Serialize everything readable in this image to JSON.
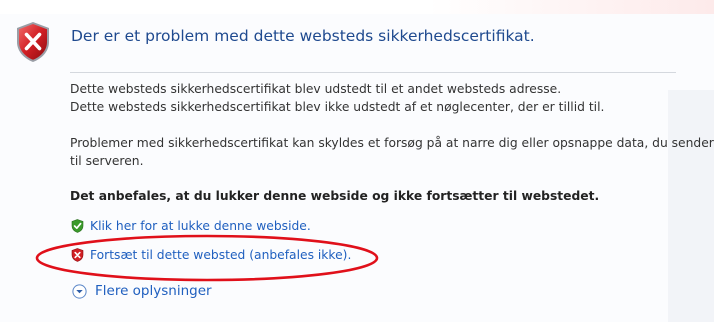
{
  "page": {
    "title": "Der er et problem med dette websteds sikkerhedscertifikat.",
    "paragraph1": [
      "Dette websteds sikkerhedscertifikat blev udstedt til et andet websteds adresse.",
      "Dette websteds sikkerhedscertifikat blev ikke udstedt af et nøglecenter, der er tillid til."
    ],
    "paragraph2": [
      "Problemer med sikkerhedscertifikat kan skyldes et forsøg på at narre dig eller opsnappe data, du sender",
      "til serveren."
    ],
    "recommendation": "Det anbefales, at du lukker denne webside og ikke fortsætter til webstedet."
  },
  "actions": {
    "close_label": "Klik her for at lukke denne webside.",
    "continue_label": "Fortsæt til dette websted (anbefales ikke).",
    "more_info_label": "Flere oplysninger"
  },
  "icons": {
    "header": "error-shield-icon",
    "close": "green-check-shield-icon",
    "continue": "red-x-shield-icon",
    "more_info": "expand-chevron-icon"
  },
  "colors": {
    "title": "#1f4a8f",
    "link": "#1f5fbf",
    "error_red": "#c8102e",
    "annotation_red": "#e0101a",
    "safe_green": "#3a9a2a"
  }
}
